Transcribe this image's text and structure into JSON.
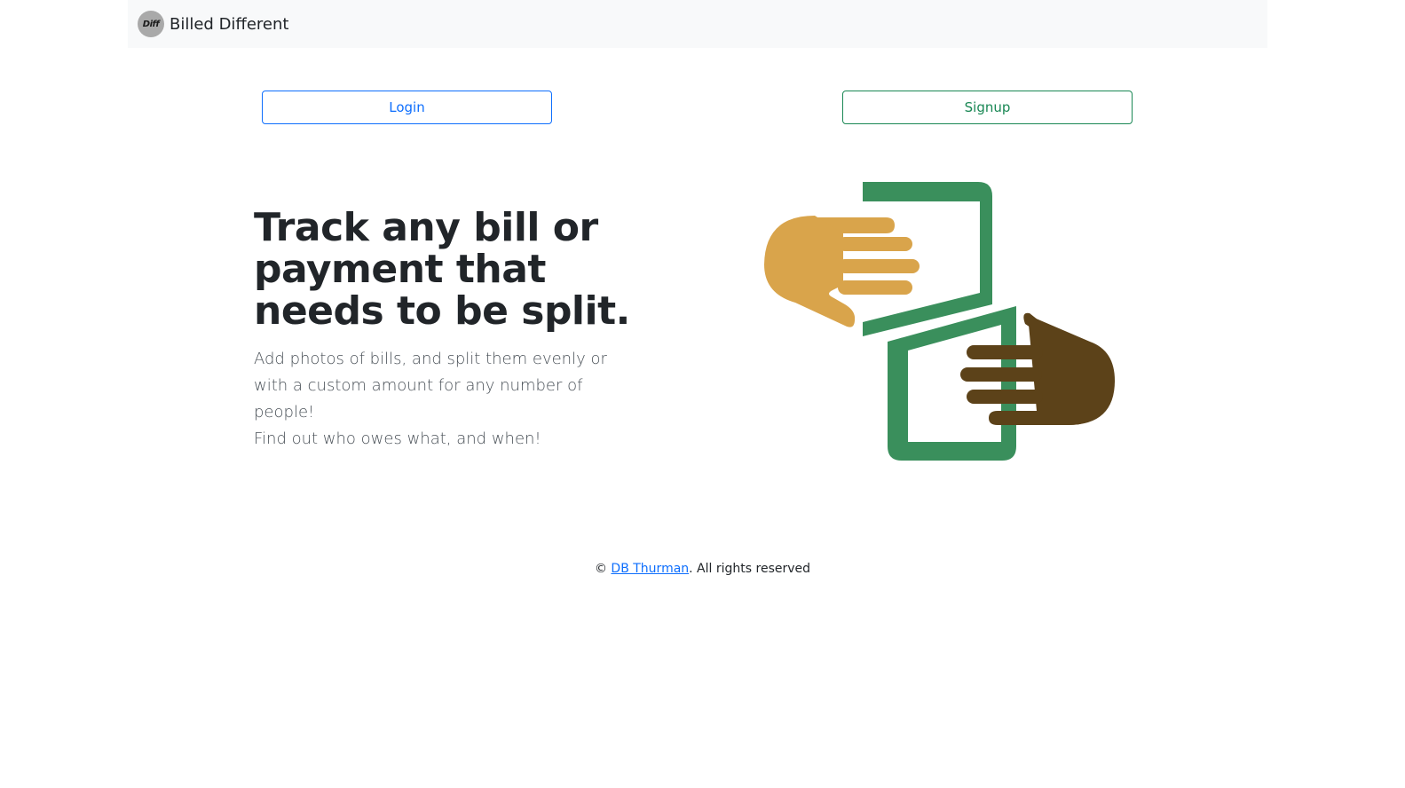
{
  "navbar": {
    "logo_text": "Diff",
    "brand_name": "Billed Different"
  },
  "buttons": {
    "login_label": "Login",
    "signup_label": "Signup"
  },
  "hero": {
    "title": "Track any bill or payment that needs to be split.",
    "description_line1": "Add photos of bills, and split them evenly or with a custom amount for any number of people!",
    "description_line2": "Find out who owes what, and when!",
    "illustration": "hands-exchanging-bill-icon"
  },
  "footer": {
    "copyright_symbol": "©",
    "author": "DB Thurman",
    "suffix": ". All rights reserved"
  },
  "colors": {
    "primary": "#0d6efd",
    "success": "#198754",
    "bill_green": "#3a8f5c",
    "hand_light": "#d9a44b",
    "hand_dark": "#5c4219",
    "navbar_bg": "#f8f9fa"
  }
}
